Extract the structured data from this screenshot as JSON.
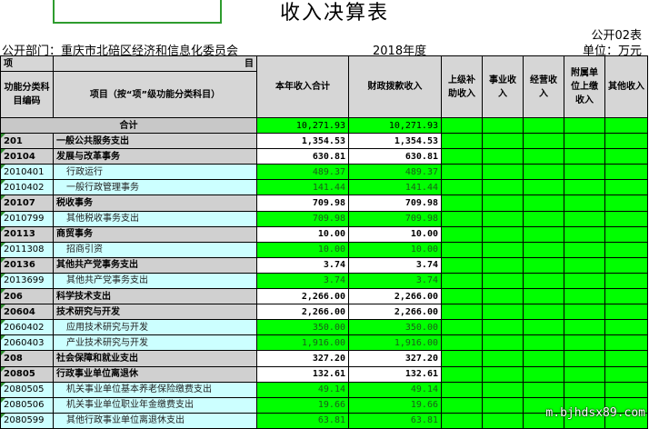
{
  "title": "收入决算表",
  "form_no": "公开02表",
  "dept_line": "公开部门：重庆市北碚区经济和信息化委员会",
  "year": "2018年度",
  "unit": "单位：万元",
  "header": {
    "xiang": "项",
    "mu": "目",
    "code": "功能分类科目编码",
    "name": "项目（按“项”级功能分类科目）",
    "cols": [
      "本年收入合计",
      "财政拨款收入",
      "上级补助收入",
      "事业收入",
      "经营收入",
      "附属单位上缴收入",
      "其他收入"
    ]
  },
  "rows": [
    {
      "level": "total",
      "code": "",
      "name": "合计",
      "total": "10,271.93",
      "fiscal": "10,271.93"
    },
    {
      "level": "lvl1",
      "code": "201",
      "name": "一般公共服务支出",
      "total": "1,354.53",
      "fiscal": "1,354.53"
    },
    {
      "level": "lvl1",
      "code": "20104",
      "name": "发展与改革事务",
      "total": "630.81",
      "fiscal": "630.81"
    },
    {
      "level": "lvl2",
      "code": "2010401",
      "name": "行政运行",
      "total": "489.37",
      "fiscal": "489.37"
    },
    {
      "level": "lvl2",
      "code": "2010402",
      "name": "一般行政管理事务",
      "total": "141.44",
      "fiscal": "141.44"
    },
    {
      "level": "lvl1",
      "code": "20107",
      "name": "税收事务",
      "total": "709.98",
      "fiscal": "709.98"
    },
    {
      "level": "lvl2",
      "code": "2010799",
      "name": "其他税收事务支出",
      "total": "709.98",
      "fiscal": "709.98"
    },
    {
      "level": "lvl1",
      "code": "20113",
      "name": "商贸事务",
      "total": "10.00",
      "fiscal": "10.00"
    },
    {
      "level": "lvl2",
      "code": "2011308",
      "name": "招商引资",
      "total": "10.00",
      "fiscal": "10.00"
    },
    {
      "level": "lvl1",
      "code": "20136",
      "name": "其他共产党事务支出",
      "total": "3.74",
      "fiscal": "3.74"
    },
    {
      "level": "lvl2",
      "code": "2013699",
      "name": "其他共产党事务支出",
      "total": "3.74",
      "fiscal": "3.74"
    },
    {
      "level": "lvl1",
      "code": "206",
      "name": "科学技术支出",
      "total": "2,266.00",
      "fiscal": "2,266.00"
    },
    {
      "level": "lvl1",
      "code": "20604",
      "name": "技术研究与开发",
      "total": "2,266.00",
      "fiscal": "2,266.00"
    },
    {
      "level": "lvl2",
      "code": "2060402",
      "name": "应用技术研究与开发",
      "total": "350.00",
      "fiscal": "350.00"
    },
    {
      "level": "lvl2",
      "code": "2060403",
      "name": "产业技术研究与开发",
      "total": "1,916.00",
      "fiscal": "1,916.00"
    },
    {
      "level": "lvl1",
      "code": "208",
      "name": "社会保障和就业支出",
      "total": "327.20",
      "fiscal": "327.20"
    },
    {
      "level": "lvl1",
      "code": "20805",
      "name": "行政事业单位离退休",
      "total": "132.61",
      "fiscal": "132.61"
    },
    {
      "level": "lvl2",
      "code": "2080505",
      "name": "机关事业单位基本养老保险缴费支出",
      "total": "49.14",
      "fiscal": "49.14"
    },
    {
      "level": "lvl2",
      "code": "2080506",
      "name": "机关事业单位职业年金缴费支出",
      "total": "19.66",
      "fiscal": "19.66"
    },
    {
      "level": "lvl2",
      "code": "2080599",
      "name": "其他行政事业单位离退休支出",
      "total": "63.81",
      "fiscal": "63.81"
    }
  ],
  "watermark": "m.bjhdsx89.com",
  "colors": {
    "highlight": "#00ff00",
    "header_gray": "#d6d6d6",
    "sub_row": "#ccffff"
  }
}
